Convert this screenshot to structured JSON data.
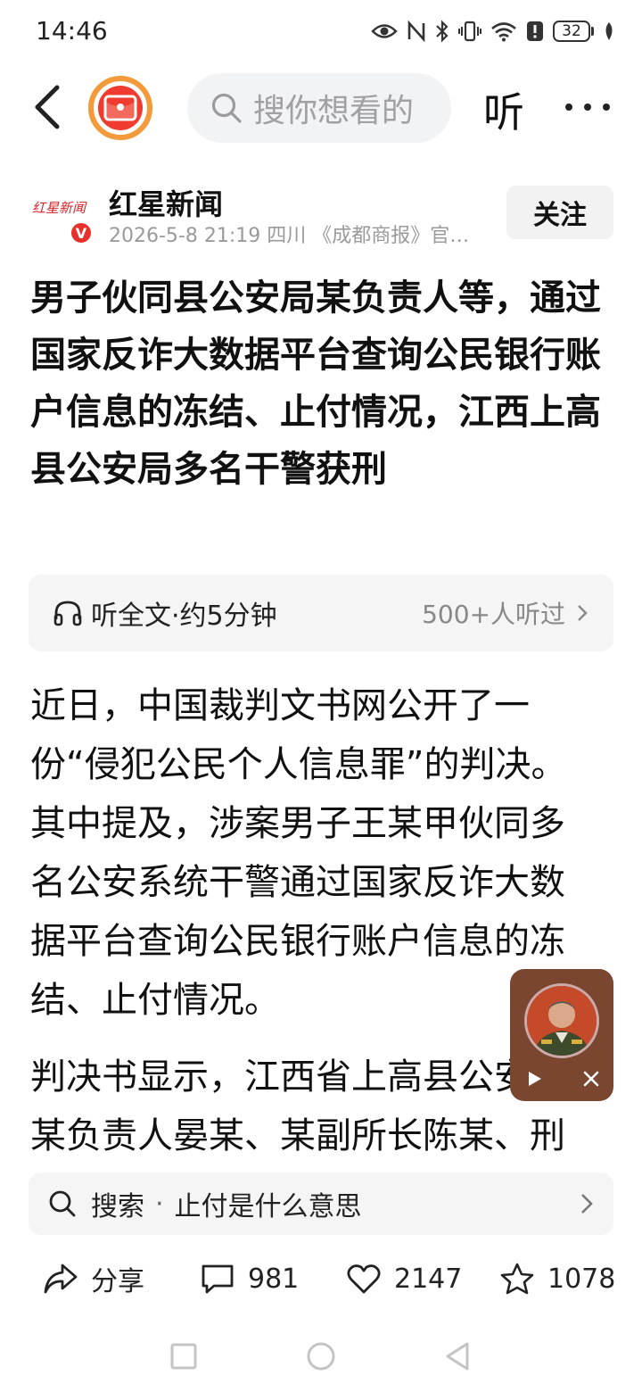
{
  "status_bar": {
    "time": "14:46",
    "battery": "32"
  },
  "nav": {
    "search_placeholder": "搜你想看的",
    "listen_label": "听"
  },
  "author": {
    "name": "红星新闻",
    "meta": "2026-5-8  21:19  四川  《成都商报》官…",
    "follow_label": "关注",
    "logo_text": "红星新闻",
    "verified_badge": "V"
  },
  "article": {
    "title": "男子伙同县公安局某负责人等，通过国家反诈大数据平台查询公民银行账户信息的冻结、止付情况，江西上高县公安局多名干警获刑",
    "audio": {
      "label": "听全文·约5分钟",
      "listeners": "500+人听过"
    },
    "paragraphs": [
      "近日，中国裁判文书网公开了一份“侵犯公民个人信息罪”的判决。其中提及，涉案男子王某甲伙同多名公安系统干警通过国家反诈大数据平台查询公民银行账户信息的冻结、止付情况。",
      "判决书显示，江西省上高县公安局某负责人晏某、某副所长陈某、刑"
    ]
  },
  "related_search": {
    "prefix": "搜索",
    "separator": "·",
    "query": "止付是什么意思"
  },
  "actions": {
    "share": "分享",
    "comments": "981",
    "likes": "2147",
    "favorites": "1078"
  },
  "colors": {
    "brand_red": "#e8312b",
    "accent_orange": "#f39a3a",
    "player_bg": "#7a4630"
  }
}
